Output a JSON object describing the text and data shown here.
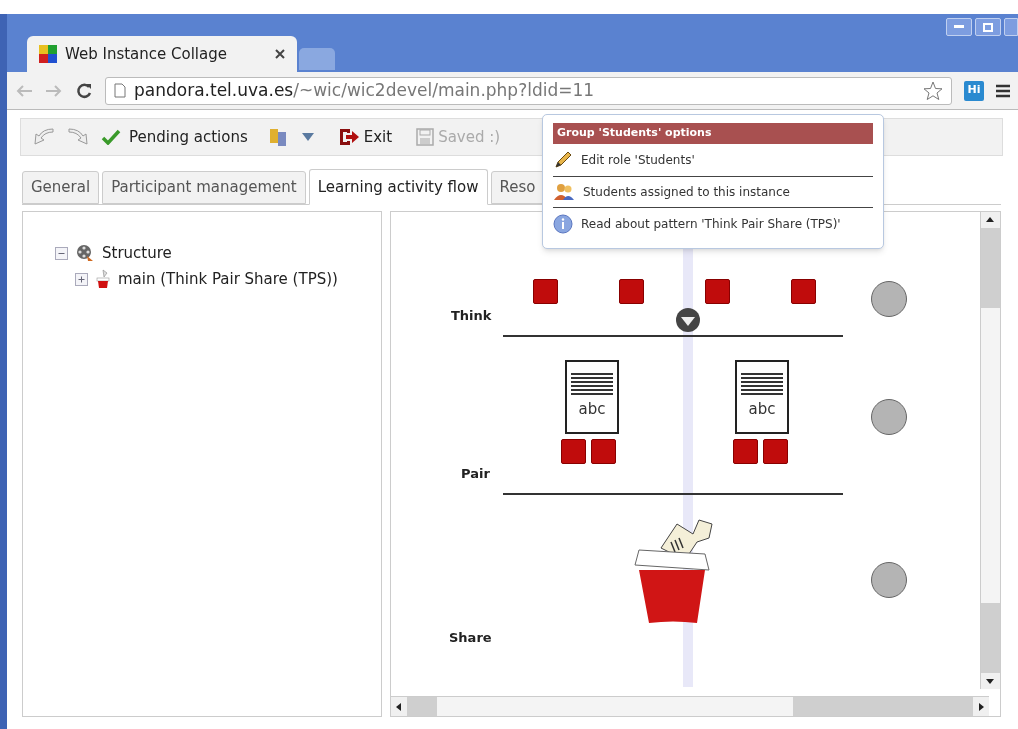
{
  "window": {
    "tab_title": "Web Instance Collage",
    "address": {
      "host": "pandora.tel.uva.es",
      "path": "/~wic/wic2devel/main.php?ldid=11"
    },
    "extension_badge": "Hi"
  },
  "toolbar": [
    {
      "kind": "check",
      "label": "Pending actions",
      "disabled": false
    },
    {
      "kind": "exit",
      "label": "Exit",
      "disabled": false
    },
    {
      "kind": "save",
      "label": "Saved :)",
      "disabled": true
    }
  ],
  "tabs": [
    {
      "label": "General",
      "selected": false
    },
    {
      "label": "Participant management",
      "selected": false
    },
    {
      "label": "Learning activity flow",
      "selected": true
    },
    {
      "label": "Reso",
      "selected": false
    }
  ],
  "tree": [
    {
      "label": "Structure",
      "kind": "structure",
      "expanded": true,
      "children": [
        {
          "label": "main (Think Pair Share (TPS))",
          "kind": "pattern",
          "expanded": false
        }
      ]
    }
  ],
  "popup": {
    "title": "Group 'Students' options",
    "items": [
      {
        "kind": "edit",
        "label": "Edit role 'Students'"
      },
      {
        "kind": "people",
        "label": "Students assigned to this instance"
      },
      {
        "kind": "info",
        "label": "Read about pattern 'Think Pair Share (TPS)'"
      }
    ]
  },
  "flow": {
    "phases": [
      {
        "label": "Think"
      },
      {
        "label": "Pair"
      },
      {
        "label": "Share"
      }
    ],
    "documents": [
      {
        "label": "abc"
      },
      {
        "label": "abc"
      }
    ]
  }
}
